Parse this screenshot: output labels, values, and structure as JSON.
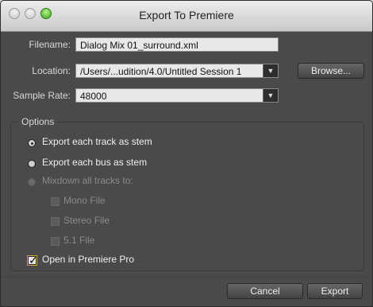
{
  "window": {
    "title": "Export To Premiere"
  },
  "form": {
    "filename_label": "Filename:",
    "filename_value": "Dialog Mix 01_surround.xml",
    "location_label": "Location:",
    "location_value": "/Users/...udition/4.0/Untitled Session 1",
    "browse_label": "Browse...",
    "sample_rate_label": "Sample Rate:",
    "sample_rate_value": "48000"
  },
  "options": {
    "title": "Options",
    "radio_export_track_stem": "Export each track as stem",
    "radio_export_bus_stem": "Export each bus as stem",
    "radio_mixdown": "Mixdown all tracks to:",
    "checkbox_mono": "Mono File",
    "checkbox_stereo": "Stereo File",
    "checkbox_51": "5.1 File",
    "checkbox_open_premiere": "Open in Premiere Pro"
  },
  "actions": {
    "cancel": "Cancel",
    "export": "Export"
  }
}
